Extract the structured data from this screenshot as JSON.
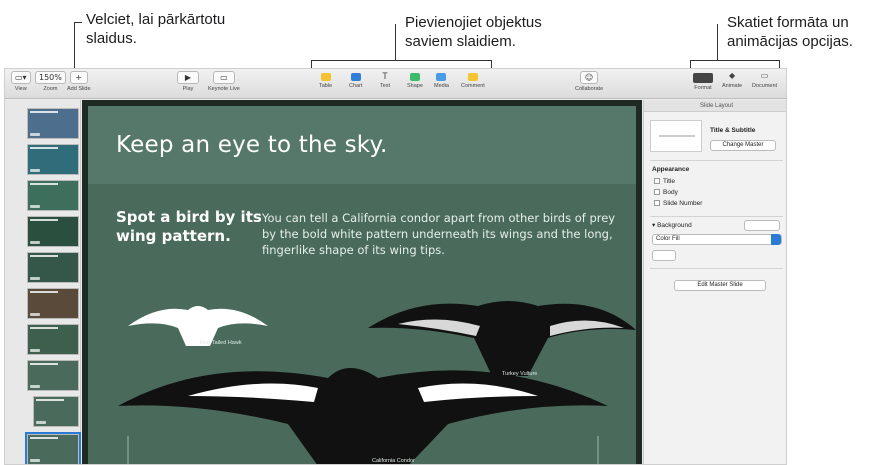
{
  "callouts": {
    "reorder_line1": "Velciet, lai pārkārtotu",
    "reorder_line2": "slaidus.",
    "add_objects_line1": "Pievienojiet objektus",
    "add_objects_line2": "saviem slaidiem.",
    "format_line1": "Skatiet formāta un",
    "format_line2": "animācijas opcijas."
  },
  "toolbar": {
    "view_label": "View",
    "zoom_value": "150%",
    "zoom_label": "Zoom",
    "add_slide_label": "Add Slide",
    "play_label": "Play",
    "keynote_live_label": "Keynote Live",
    "table_label": "Table",
    "chart_label": "Chart",
    "text_label": "Text",
    "shape_label": "Shape",
    "media_label": "Media",
    "comment_label": "Comment",
    "collaborate_label": "Collaborate",
    "format_label": "Format",
    "animate_label": "Animate",
    "document_label": "Document"
  },
  "navigator": {
    "slide_count_visible": 11,
    "selected_index": 11
  },
  "slide": {
    "title": "Keep an eye to the sky.",
    "subtitle_line1": "Spot a bird by its",
    "subtitle_line2": "wing pattern.",
    "body": "You can tell a California condor apart from other birds of prey by the bold white pattern underneath its wings and the long, fingerlike shape of its wing tips.",
    "bird1_label": "Red-Tailed Hawk",
    "bird2_label": "Turkey Vulture",
    "bird3_label": "California Condor"
  },
  "inspector": {
    "tab_label": "Slide Layout",
    "layout_name": "Title & Subtitle",
    "change_master": "Change Master",
    "appearance": "Appearance",
    "title_opt": "Title",
    "body_opt": "Body",
    "slide_number_opt": "Slide Number",
    "background": "Background",
    "fill_type": "Color Fill",
    "edit_master": "Edit Master Slide"
  },
  "colors": {
    "slide_bg": "#4a6b5c",
    "selection": "#2a7bd8"
  }
}
